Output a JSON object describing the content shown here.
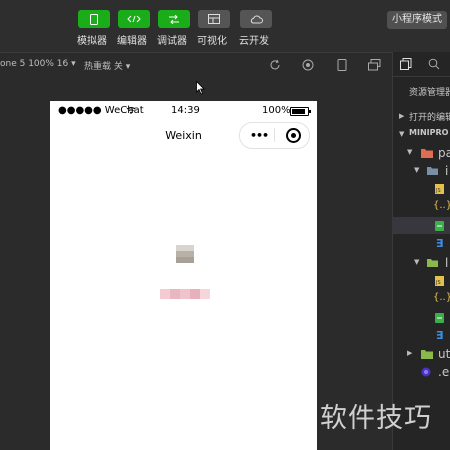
{
  "toolbar": {
    "simulator_label": "模拟器",
    "editor_label": "编辑器",
    "debugger_label": "调试器",
    "visual_label": "可视化",
    "cloud_label": "云开发",
    "mode_label": "小程序模式"
  },
  "subbar": {
    "device_label": "one 5 100% 16 ▾",
    "hot_reload_label": "热重载 关 ▾"
  },
  "phone": {
    "carrier": "●●●●● WeChat",
    "time": "14:39",
    "battery": "100%",
    "nav_title": "Weixin"
  },
  "explorer": {
    "title": "资源管理器",
    "open_editors": "打开的编辑",
    "project": "MINIPRO",
    "items": [
      "pa",
      "i",
      "l",
      "ut",
      ".e"
    ]
  },
  "watermark": "软件技巧",
  "colors": {
    "accent": "#1aad19",
    "bg": "#2b2b2b"
  }
}
